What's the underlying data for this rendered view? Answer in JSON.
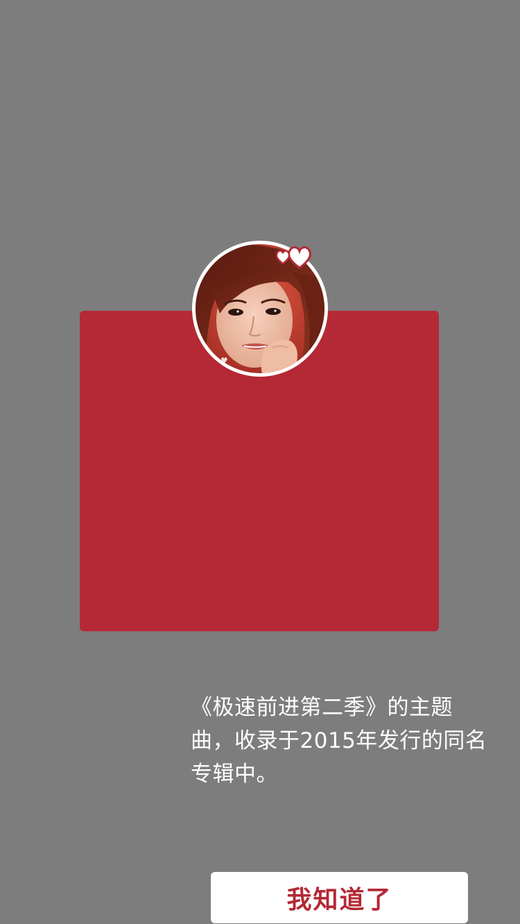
{
  "dialog": {
    "avatar_icon": "singer-portrait-avatar",
    "badge_icon": "heart-icon",
    "message": "《极速前进第二季》的主题曲，收录于2015年发行的同名专辑中。",
    "confirm_label": "我知道了"
  },
  "colors": {
    "overlay": "#7d7d7d",
    "dialog_background": "#b42935",
    "button_background": "#ffffff",
    "button_text": "#b42935",
    "message_text": "#ffffff"
  }
}
